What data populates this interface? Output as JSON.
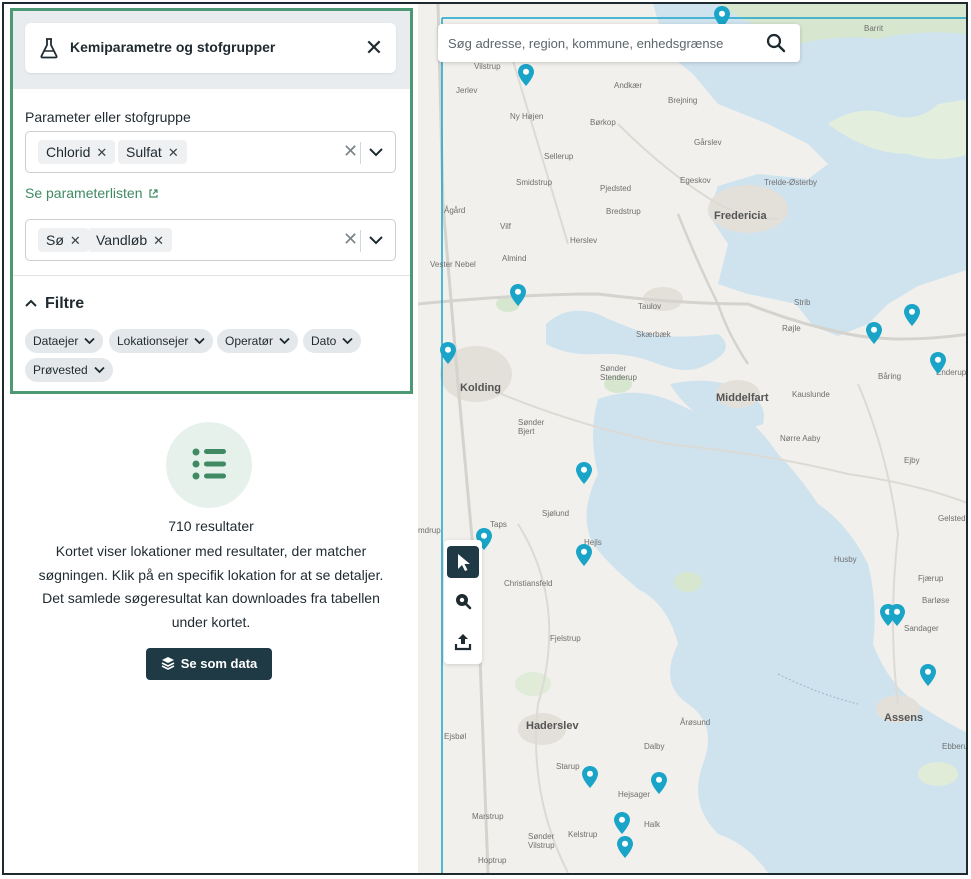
{
  "panel": {
    "title": "Kemiparametre og stofgrupper",
    "param_label": "Parameter eller stofgruppe",
    "param_chips": [
      "Chlorid",
      "Sulfat"
    ],
    "param_link": "Se parameterlisten",
    "type_chips": [
      "Sø",
      "Vandløb"
    ],
    "filter_heading": "Filtre",
    "filters": [
      "Dataejer",
      "Lokationsejer",
      "Operatør",
      "Dato",
      "Prøvested"
    ]
  },
  "results": {
    "count": "710 resultater",
    "description": "Kortet viser lokationer med resultater, der matcher søgningen. Klik på en specifik lokation for at se detaljer. Det samlede søgeresultat kan downloades fra tabellen under kortet.",
    "button_label": "Se som data"
  },
  "map": {
    "search_placeholder": "Søg adresse, region, kommune, enhedsgrænse",
    "places": [
      {
        "name": "Barrit",
        "type": "town"
      },
      {
        "name": "Vilstrup",
        "type": "town"
      },
      {
        "name": "Jerlev",
        "type": "town"
      },
      {
        "name": "Andkær",
        "type": "town"
      },
      {
        "name": "Brejning",
        "type": "town"
      },
      {
        "name": "Ny Højen",
        "type": "town"
      },
      {
        "name": "Børkop",
        "type": "town"
      },
      {
        "name": "Gårslev",
        "type": "town"
      },
      {
        "name": "Sellerup",
        "type": "town"
      },
      {
        "name": "Egeskov",
        "type": "town"
      },
      {
        "name": "Trelde-Østerby",
        "type": "town"
      },
      {
        "name": "Smidstrup",
        "type": "town"
      },
      {
        "name": "Pjedsted",
        "type": "town"
      },
      {
        "name": "Bredstrup",
        "type": "town"
      },
      {
        "name": "Fredericia",
        "type": "city"
      },
      {
        "name": "Vilf",
        "type": "town"
      },
      {
        "name": "Herslev",
        "type": "town"
      },
      {
        "name": "Ågård",
        "type": "town"
      },
      {
        "name": "Almind",
        "type": "town"
      },
      {
        "name": "Vester Nebel",
        "type": "town"
      },
      {
        "name": "Taulov",
        "type": "town"
      },
      {
        "name": "Strib",
        "type": "town"
      },
      {
        "name": "Røjle",
        "type": "town"
      },
      {
        "name": "Skærbæk",
        "type": "town"
      },
      {
        "name": "Båring",
        "type": "town"
      },
      {
        "name": "Enderup",
        "type": "town"
      },
      {
        "name": "Kolding",
        "type": "city"
      },
      {
        "name": "Sønder Stenderup",
        "type": "town"
      },
      {
        "name": "Middelfart",
        "type": "city"
      },
      {
        "name": "Kauslunde",
        "type": "town"
      },
      {
        "name": "Sønder Bjert",
        "type": "town"
      },
      {
        "name": "Nørre Aaby",
        "type": "town"
      },
      {
        "name": "Ejby",
        "type": "town"
      },
      {
        "name": "Sjølund",
        "type": "town"
      },
      {
        "name": "Gelsted",
        "type": "town"
      },
      {
        "name": "Taps",
        "type": "town"
      },
      {
        "name": "Hejls",
        "type": "town"
      },
      {
        "name": "Christiansfeld",
        "type": "town"
      },
      {
        "name": "Husby",
        "type": "town"
      },
      {
        "name": "Fjærup",
        "type": "town"
      },
      {
        "name": "Barløse",
        "type": "town"
      },
      {
        "name": "Sandager",
        "type": "town"
      },
      {
        "name": "Fjelstrup",
        "type": "town"
      },
      {
        "name": "Haderslev",
        "type": "city"
      },
      {
        "name": "Årøsund",
        "type": "town"
      },
      {
        "name": "Assens",
        "type": "city"
      },
      {
        "name": "Ejsbøl",
        "type": "town"
      },
      {
        "name": "Dalby",
        "type": "town"
      },
      {
        "name": "Ebberup",
        "type": "town"
      },
      {
        "name": "Starup",
        "type": "town"
      },
      {
        "name": "Hejsager",
        "type": "town"
      },
      {
        "name": "Marstrup",
        "type": "town"
      },
      {
        "name": "Halk",
        "type": "town"
      },
      {
        "name": "Kelstrup",
        "type": "town"
      },
      {
        "name": "Sønder Vilstrup",
        "type": "town"
      },
      {
        "name": "Hoptrup",
        "type": "town"
      },
      {
        "name": "mdrup",
        "type": "town"
      }
    ],
    "pin_color": "#19a4c8"
  },
  "colors": {
    "accent_green": "#4c9a73",
    "dark_button": "#1f3a44",
    "water": "#cfe3ef",
    "border": "#1f2a30"
  }
}
